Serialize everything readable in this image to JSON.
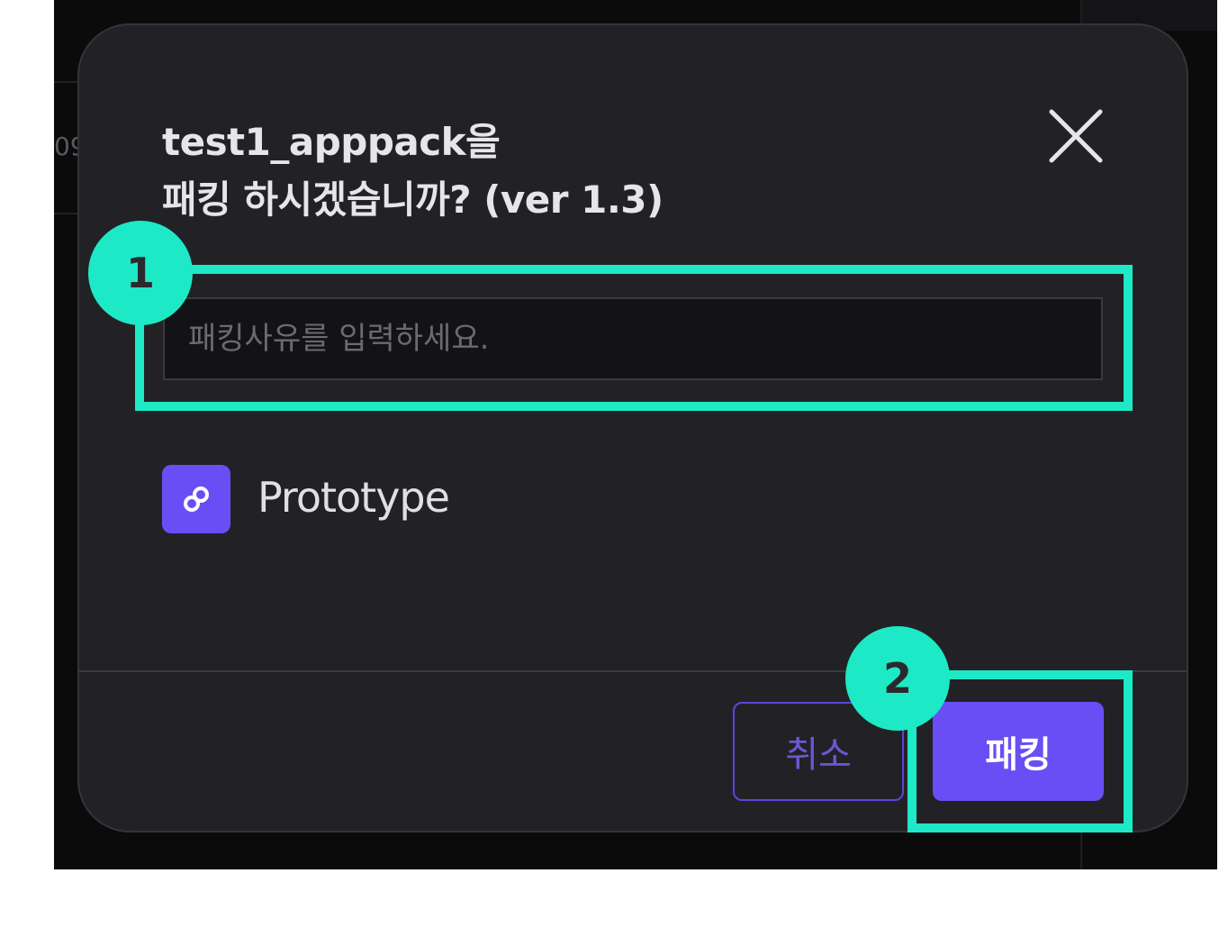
{
  "dialog": {
    "title_line1": "test1_apppack을",
    "title_line2": "패킹 하시겠습니까? (ver 1.3)",
    "close_icon": "close-icon",
    "input": {
      "placeholder": "패킹사유를 입력하세요.",
      "value": ""
    },
    "option": {
      "icon": "link-icon",
      "label": "Prototype"
    },
    "buttons": {
      "cancel_label": "취소",
      "confirm_label": "패킹"
    }
  },
  "annotations": {
    "step1": "1",
    "step2": "2",
    "highlight_color": "#1de9c6"
  },
  "colors": {
    "accent": "#6a4ef5",
    "modal_bg": "#222226",
    "backdrop": "#0b0b0c"
  }
}
